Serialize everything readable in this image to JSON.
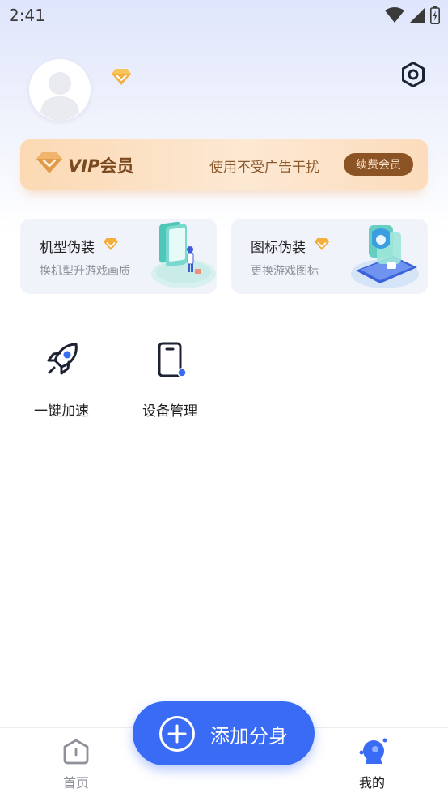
{
  "status_bar": {
    "time": "2:41",
    "icons": [
      "wifi-icon",
      "cell-signal-icon",
      "battery-icon"
    ]
  },
  "profile": {
    "avatar_icon": "default-user-avatar",
    "badge_icon": "vip-diamond-icon",
    "settings_icon": "settings-hexagon-icon"
  },
  "vip_banner": {
    "vip_text": "VIP",
    "member_text": "会员",
    "slogan": "使用不受广告干扰",
    "renew_button": "续费会员"
  },
  "feature_cards": [
    {
      "title": "机型伪装",
      "subtitle": "换机型升游戏画质",
      "icon": "phone-model-illustration"
    },
    {
      "title": "图标伪装",
      "subtitle": "更换游戏图标",
      "icon": "app-icon-illustration"
    }
  ],
  "tools": [
    {
      "label": "一键加速",
      "icon": "rocket-icon"
    },
    {
      "label": "设备管理",
      "icon": "phone-device-icon"
    }
  ],
  "fab": {
    "label": "添加分身",
    "icon": "plus-circle-icon"
  },
  "bottom_nav": [
    {
      "label": "首页",
      "icon": "home-hexagon-icon",
      "active": false
    },
    {
      "label": "我的",
      "icon": "profile-user-icon",
      "active": true
    }
  ],
  "colors": {
    "accent": "#3a6bf5",
    "vip_brown": "#8c5324",
    "vip_gold": "#f0a53a",
    "text_primary": "#222222",
    "text_secondary": "#8d8f98"
  }
}
